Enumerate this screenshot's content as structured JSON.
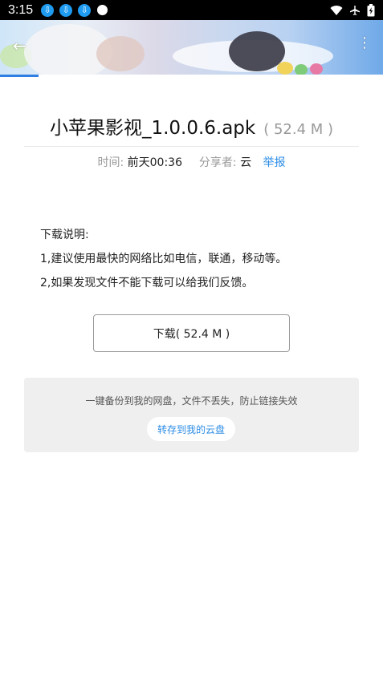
{
  "status_bar": {
    "time": "3:15",
    "icons": [
      "download-icon",
      "download-icon",
      "download-icon",
      "dot-icon",
      "wifi-icon",
      "airplane-icon",
      "battery-icon"
    ]
  },
  "banner": {
    "loading_progress": 0.1
  },
  "file": {
    "name": "小苹果影视_1.0.0.6.apk",
    "size": "( 52.4 M )"
  },
  "meta": {
    "time_label": "时间:",
    "time_value": "前天00:36",
    "sharer_label": "分享者:",
    "sharer_value": "云",
    "report_label": "举报"
  },
  "notes": {
    "heading": "下载说明:",
    "line1": "1,建议使用最快的网络比如电信，联通，移动等。",
    "line2": "2,如果发现文件不能下载可以给我们反馈。"
  },
  "download_button": {
    "label": "下载( 52.4 M )"
  },
  "save_panel": {
    "tip": "一键备份到我的网盘，文件不丢失，防止链接失效",
    "button_label": "转存到我的云盘"
  },
  "colors": {
    "accent": "#2b8ce6",
    "progress": "#2f7fe3",
    "status_download": "#1e9bf0"
  }
}
